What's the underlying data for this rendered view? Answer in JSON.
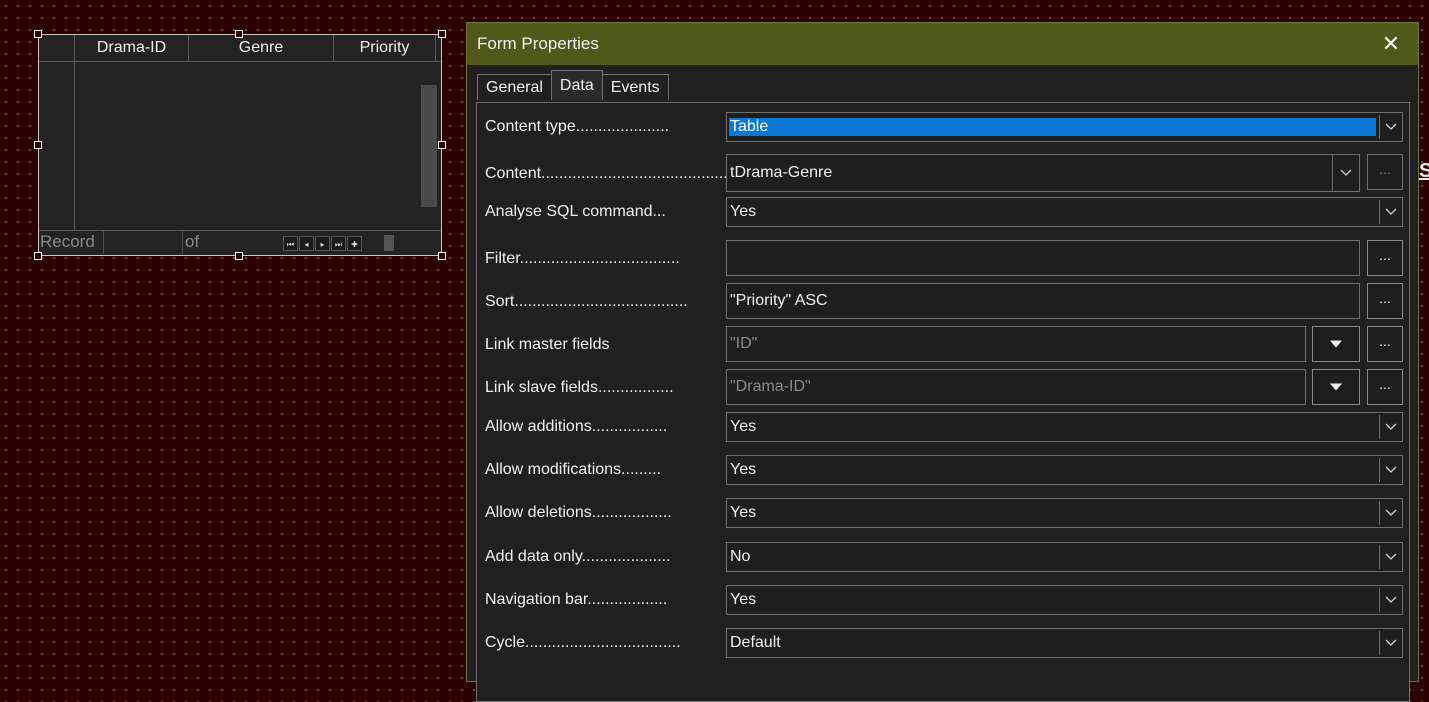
{
  "grid": {
    "columns": [
      "Drama-ID",
      "Genre",
      "Priority"
    ],
    "nav_record": "Record",
    "nav_of": "of",
    "nav_buttons": [
      "⏮",
      "◂",
      "▸",
      "⏭",
      "✚"
    ]
  },
  "canvas_letter": "S",
  "dialog": {
    "title": "Form Properties",
    "close_glyph": "✕",
    "tabs": [
      "General",
      "Data",
      "Events"
    ],
    "active_tab": "Data",
    "browse_label": "...",
    "fields": {
      "content_type": {
        "label": "Content type.....................",
        "value": "Table"
      },
      "content": {
        "label": "Content...........................................",
        "value": "tDrama-Genre"
      },
      "analyse_sql": {
        "label": "Analyse SQL command...",
        "value": "Yes"
      },
      "filter": {
        "label": "Filter....................................",
        "value": ""
      },
      "sort": {
        "label": "Sort.......................................",
        "value": "\"Priority\" ASC"
      },
      "link_master": {
        "label": "Link master fields",
        "value": "\"ID\""
      },
      "link_slave": {
        "label": "Link slave fields.................",
        "value": "\"Drama-ID\""
      },
      "allow_additions": {
        "label": "Allow additions.................",
        "value": "Yes"
      },
      "allow_modifications": {
        "label": "Allow modifications.........",
        "value": "Yes"
      },
      "allow_deletions": {
        "label": "Allow deletions..................",
        "value": "Yes"
      },
      "add_data_only": {
        "label": "Add data only....................",
        "value": "No"
      },
      "navigation_bar": {
        "label": "Navigation bar..................",
        "value": "Yes"
      },
      "cycle": {
        "label": "Cycle...................................",
        "value": "Default"
      }
    }
  },
  "colors": {
    "canvas_bg": "#2d0000",
    "titlebar": "#4f5a1a",
    "selection": "#0a78d4"
  }
}
